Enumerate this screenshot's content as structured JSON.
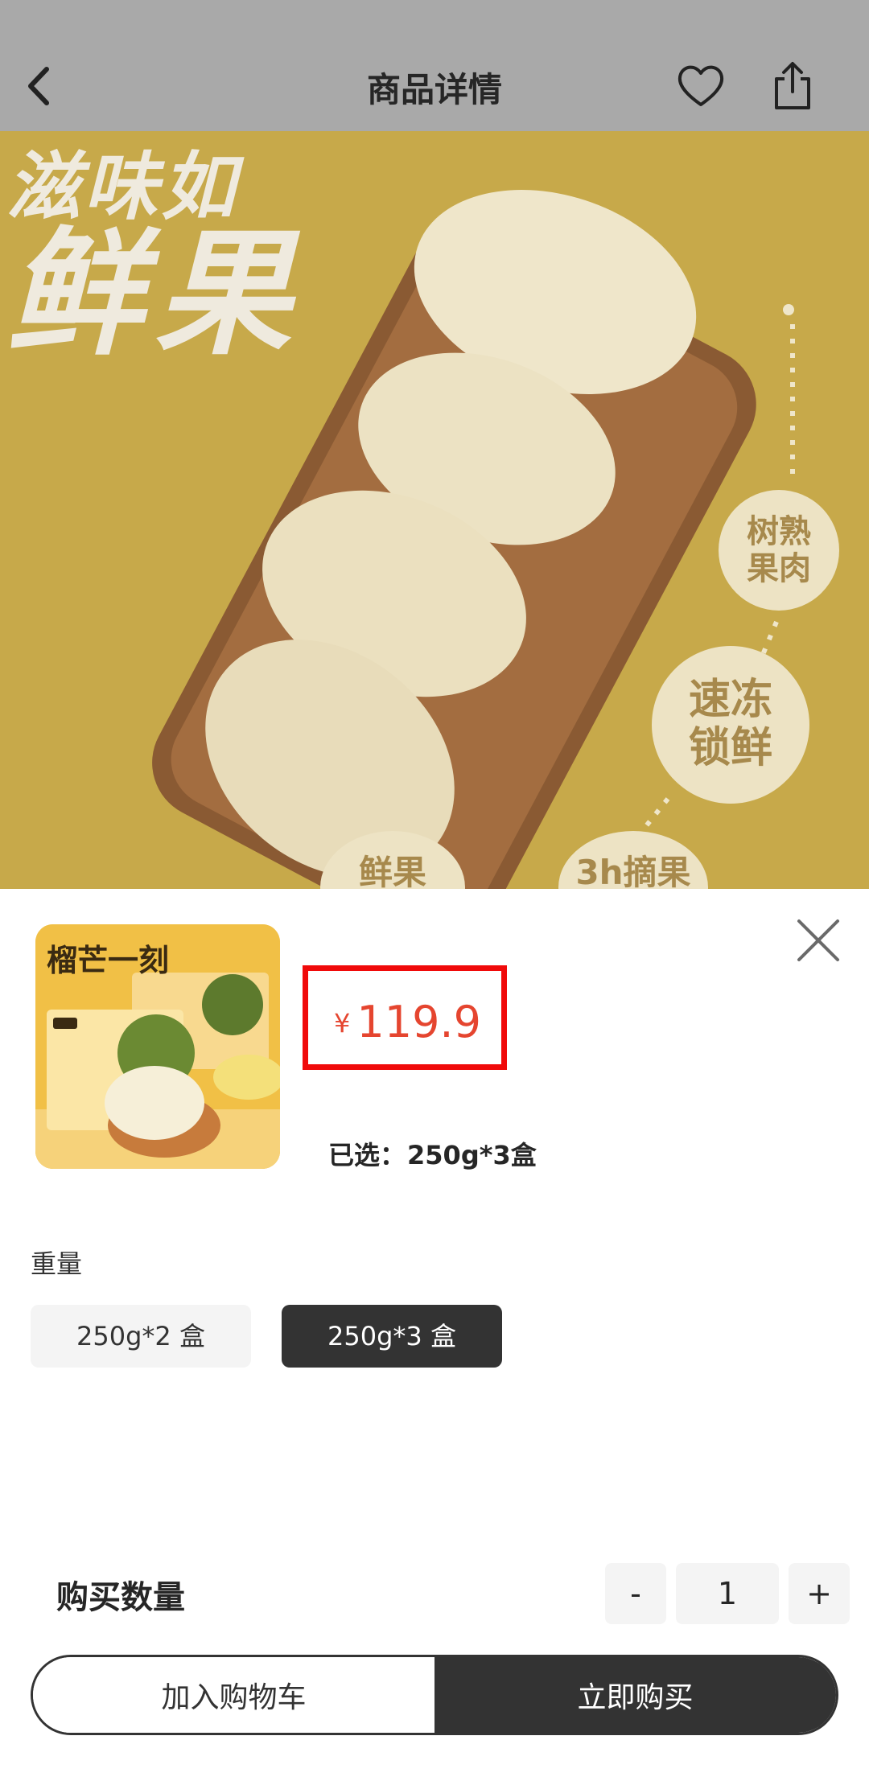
{
  "header": {
    "title": "商品详情",
    "back_icon": "chevron-left-icon",
    "favorite_icon": "heart-icon",
    "share_icon": "share-icon"
  },
  "hero": {
    "headline_line1": "滋味如",
    "headline_line2": "鲜果",
    "badges": [
      "树熟\n果肉",
      "速冻\n锁鲜",
      "鲜果",
      "3h摘果"
    ]
  },
  "sheet": {
    "thumbnail_brand": "榴芒一刻",
    "price_currency": "¥",
    "price_value": "119.9",
    "selected_label": "已选：",
    "selected_value": "250g*3盒",
    "close_icon": "close-icon",
    "weight": {
      "label": "重量",
      "options": [
        {
          "label": "250g*2 盒",
          "selected": false
        },
        {
          "label": "250g*3 盒",
          "selected": true
        }
      ]
    },
    "quantity": {
      "label": "购买数量",
      "minus": "-",
      "value": "1",
      "plus": "+"
    },
    "actions": {
      "add_to_cart": "加入购物车",
      "buy_now": "立即购买"
    }
  },
  "colors": {
    "price": "#e5452f",
    "highlight_border": "#f00a0a",
    "dark_button": "#333333",
    "hero_background": "#c7a94a"
  }
}
